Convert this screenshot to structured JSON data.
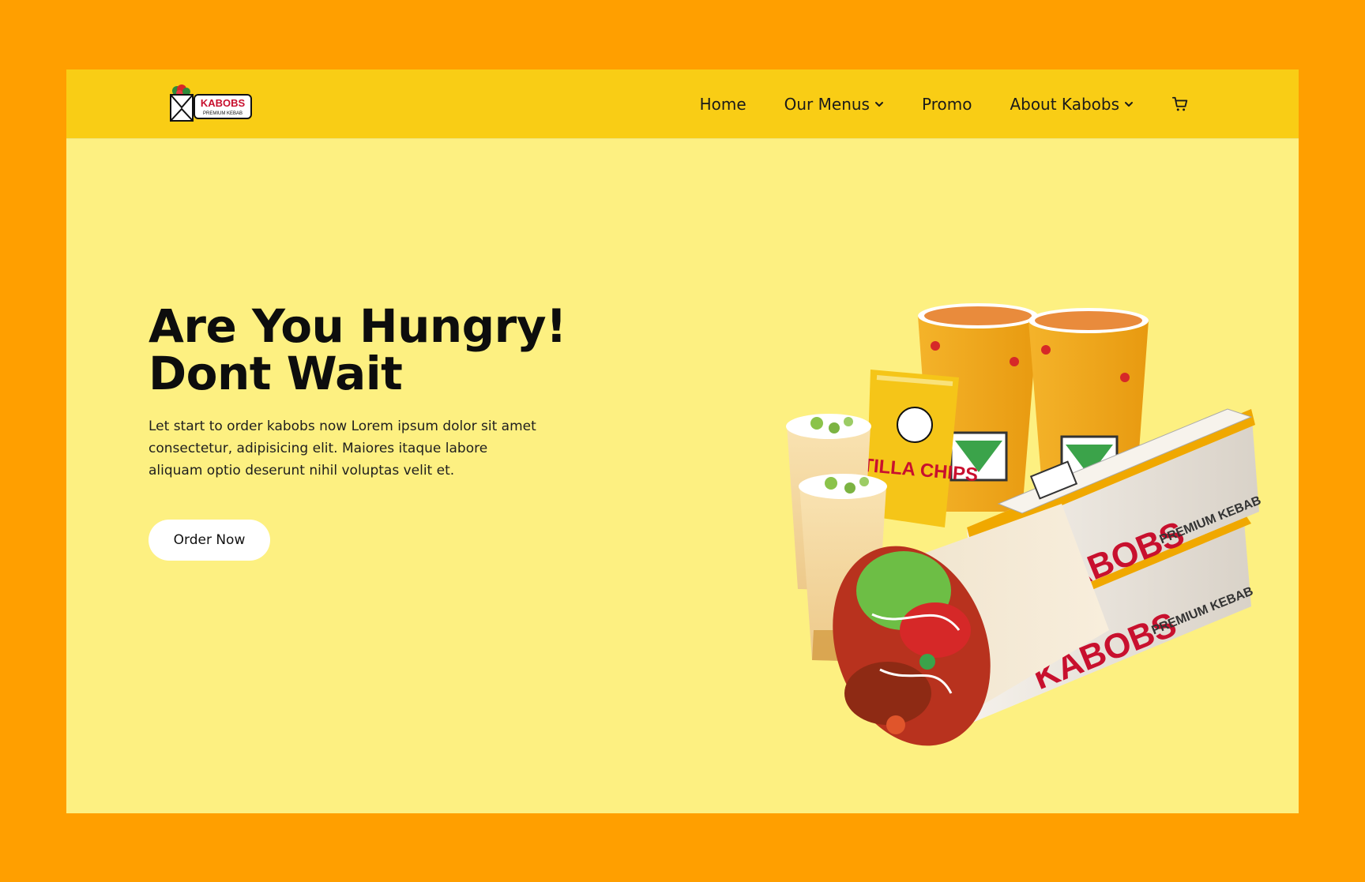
{
  "brand": {
    "logo_text": "KABOBS",
    "logo_subtext": "PREMIUM KEBAB",
    "colors": {
      "background": "#FF9F00",
      "navbar": "#F9CD15",
      "hero": "#FDF081",
      "accent_red": "#C8102E"
    }
  },
  "nav": {
    "items": [
      {
        "label": "Home",
        "has_dropdown": false
      },
      {
        "label": "Our Menus",
        "has_dropdown": true
      },
      {
        "label": "Promo",
        "has_dropdown": false
      },
      {
        "label": "About Kabobs",
        "has_dropdown": true
      }
    ],
    "cart_icon": "cart-icon"
  },
  "hero": {
    "title_line1": "Are You Hungry!",
    "title_line2": "Dont Wait",
    "description": "Let start to order kabobs now Lorem ipsum dolor sit amet consectetur, adipisicing elit. Maiores itaque labore aliquam optio deserunt nihil voluptas velit et.",
    "cta_label": "Order Now"
  },
  "product_image": {
    "box_brand": "KABOBS",
    "box_sub": "PREMIUM KEBAB",
    "chips_text": "TILLA CHIPS"
  }
}
